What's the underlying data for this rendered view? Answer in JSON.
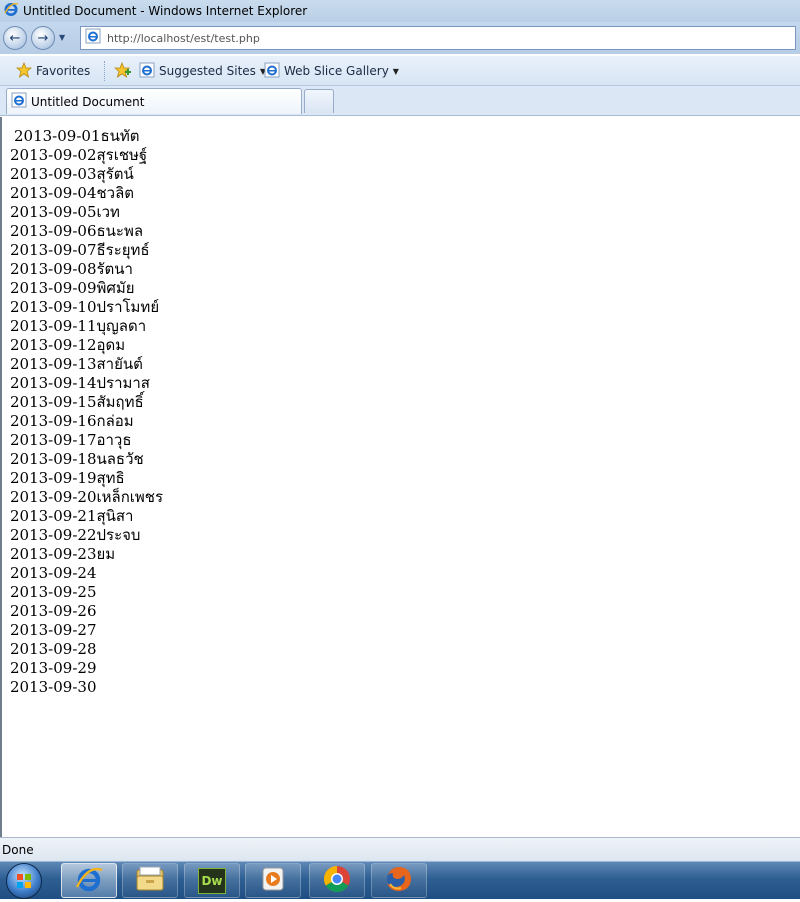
{
  "window": {
    "title": "Untitled Document - Windows Internet Explorer"
  },
  "address_bar": {
    "url": "http://localhost/est/test.php"
  },
  "favorites_bar": {
    "favorites_label": "Favorites",
    "items": [
      {
        "label": "Suggested Sites"
      },
      {
        "label": "Web Slice Gallery"
      }
    ]
  },
  "tabs": [
    {
      "label": "Untitled Document"
    }
  ],
  "content": {
    "lines": [
      "2013-09-01ธนทัต",
      "2013-09-02สุรเชษฐ์",
      "2013-09-03สุรัตน์",
      "2013-09-04ชวลิต",
      "2013-09-05เวท",
      "2013-09-06ธนะพล",
      "2013-09-07ธีระยุทธ์",
      "2013-09-08รัตนา",
      "2013-09-09พิศมัย",
      "2013-09-10ปราโมทย์",
      "2013-09-11บุญลดา",
      "2013-09-12อุดม",
      "2013-09-13สายันต์",
      "2013-09-14ปรามาส",
      "2013-09-15สัมฤทธิ์",
      "2013-09-16กล่อม",
      "2013-09-17อาวุธ",
      "2013-09-18นลธวัช",
      "2013-09-19สุทธิ",
      "2013-09-20เหล็กเพชร",
      "2013-09-21สุนิสา",
      "2013-09-22ประจบ",
      "2013-09-23ยม",
      "2013-09-24",
      "2013-09-25",
      "2013-09-26",
      "2013-09-27",
      "2013-09-28",
      "2013-09-29",
      "2013-09-30"
    ]
  },
  "status_bar": {
    "text": "Done"
  },
  "taskbar": {
    "apps": [
      {
        "icon": "internet-explorer-icon",
        "active": true
      },
      {
        "icon": "windows-explorer-icon",
        "active": false
      },
      {
        "icon": "dreamweaver-icon",
        "active": false
      },
      {
        "icon": "media-player-icon",
        "active": false
      },
      {
        "icon": "chrome-icon",
        "active": false
      },
      {
        "icon": "firefox-icon",
        "active": false
      }
    ]
  },
  "colors": {
    "ie_blue": "#1f6fd1",
    "taskbar": "#2e5f93",
    "chrome_frame": "#c4d8ee"
  }
}
